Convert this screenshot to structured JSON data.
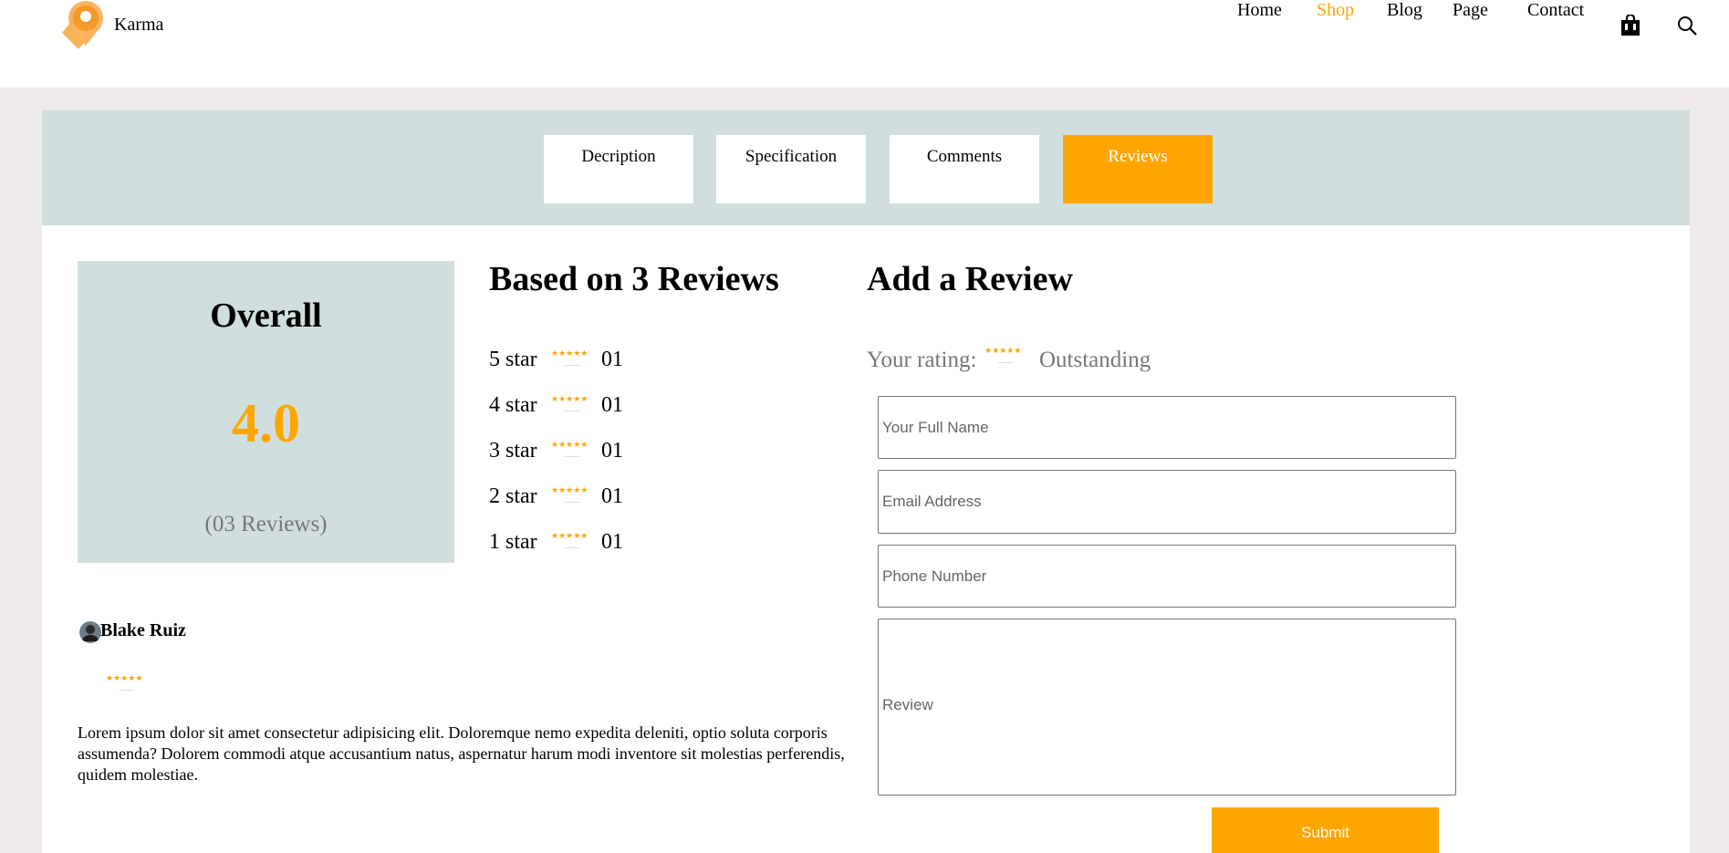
{
  "brand": {
    "name": "Karma",
    "logo_icon": "location-pin-logo-icon"
  },
  "nav": {
    "items": [
      {
        "label": "Home"
      },
      {
        "label": "Shop",
        "active": true
      },
      {
        "label": "Blog"
      },
      {
        "label": "Page"
      },
      {
        "label": "Contact"
      }
    ],
    "cart_icon": "shopping-bag-icon",
    "search_icon": "search-icon"
  },
  "tabs": [
    {
      "label": "Decription"
    },
    {
      "label": "Specification"
    },
    {
      "label": "Comments"
    },
    {
      "label": "Reviews",
      "active": true
    }
  ],
  "overall": {
    "title": "Overall",
    "score": "4.0",
    "count": "(03 Reviews)"
  },
  "breakdown": {
    "title": "Based on 3 Reviews",
    "rows": [
      {
        "label": "5 star",
        "stars": "★★★★★",
        "count": "01"
      },
      {
        "label": "4 star",
        "stars": "★★★★★",
        "count": "01"
      },
      {
        "label": "3 star",
        "stars": "★★★★★",
        "count": "01"
      },
      {
        "label": "2 star",
        "stars": "★★★★★",
        "count": "01"
      },
      {
        "label": "1 star",
        "stars": "★★★★★",
        "count": "01"
      }
    ]
  },
  "add_review": {
    "title": "Add a Review",
    "rating_label": "Your rating:",
    "rating_stars": "★★★★★",
    "rating_value": "Outstanding",
    "name_placeholder": "Your Full Name",
    "email_placeholder": "Email Address",
    "phone_placeholder": "Phone Number",
    "review_placeholder": "Review",
    "submit_label": "Submit"
  },
  "review": {
    "author": "Blake Ruiz",
    "stars": "★★★★★",
    "text": "Lorem ipsum dolor sit amet consectetur adipisicing elit. Doloremque nemo expedita deleniti, optio soluta corporis assumenda? Dolorem commodi atque accusantium natus, aspernatur harum modi inventore sit molestias perferendis, quidem molestiae."
  },
  "colors": {
    "accent": "#ffa500",
    "panel": "#d0dfde",
    "page_bg": "#efebea"
  }
}
